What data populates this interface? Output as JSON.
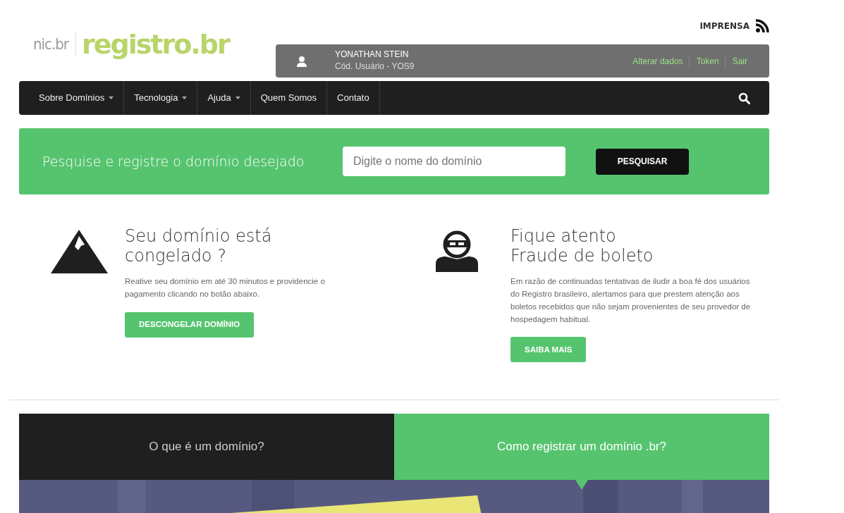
{
  "logo": {
    "org": "nic.br",
    "brand": "registro.br"
  },
  "press_link": "IMPRENSA",
  "user": {
    "name": "YONATHAN STEIN",
    "code": "Cód. Usuário - YOS9",
    "links": [
      "Alterar dados",
      "Token",
      "Sair"
    ]
  },
  "nav": [
    {
      "label": "Sobre Domínios",
      "dropdown": true
    },
    {
      "label": "Tecnologia",
      "dropdown": true
    },
    {
      "label": "Ajuda",
      "dropdown": true
    },
    {
      "label": "Quem Somos",
      "dropdown": false
    },
    {
      "label": "Contato",
      "dropdown": false
    }
  ],
  "search": {
    "title": "Pesquise e registre o domínio desejado",
    "placeholder": "Digite o nome do domínio",
    "button": "PESQUISAR"
  },
  "features": [
    {
      "kind": "mountain",
      "title": "Seu domínio está\ncongelado ?",
      "text": "Reative seu domínio em até 30 minutos e providencie o pagamento clicando no botão abaixo.",
      "button": "DESCONGELAR DOMÍNIO"
    },
    {
      "kind": "thief",
      "title": "Fique atento\nFraude de boleto",
      "text": "Em razão de continuadas tentativas de iludir a boa fé dos usuários do Registro brasileiro, alertamos para que prestem atenção aos boletos recebidos que não sejam provenientes de seu provedor de hospedagem habitual.",
      "button": "SAIBA MAIS"
    }
  ],
  "tabs": [
    {
      "label": "O que é um domínio?",
      "selected": false
    },
    {
      "label": "Como registrar um domínio .br?",
      "selected": true
    }
  ]
}
